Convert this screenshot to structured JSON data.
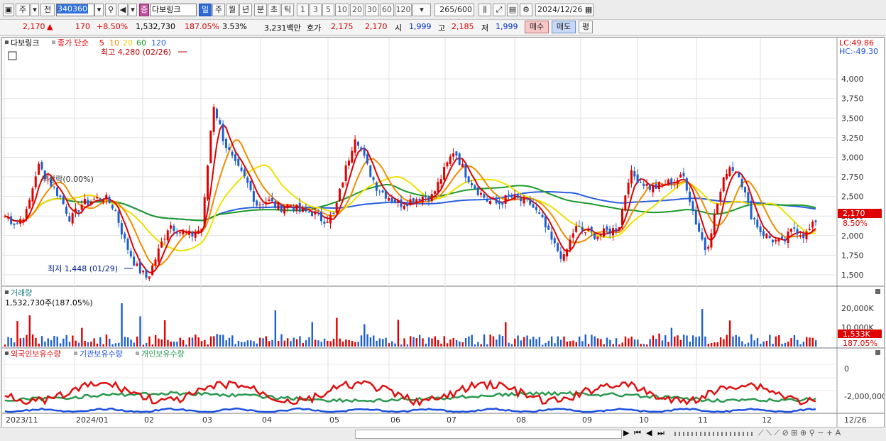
{
  "toolbar": {
    "period_main": "주",
    "prev_label": "전",
    "code": "340360",
    "stock_name": "다보링크",
    "badge": "증",
    "periods": [
      "일",
      "주",
      "월",
      "년",
      "분",
      "초",
      "틱"
    ],
    "intervals": [
      "1",
      "3",
      "5",
      "10",
      "20",
      "30",
      "60",
      "120"
    ],
    "count": "265",
    "count_total": "600",
    "date": "2024/12/26"
  },
  "quote": {
    "price": "2,170",
    "arrow": "▲",
    "change": "170",
    "change_pct": "+8.50%",
    "volume": "1,532,730",
    "vol_ratio": "187.05%",
    "turnover": "3.53%",
    "amount": "3,231백만",
    "bid_label": "호가",
    "ask": "2,175",
    "bid": "2,170",
    "open_label": "시",
    "open": "1,999",
    "high_label": "고",
    "high": "2,185",
    "low_label": "저",
    "low": "1,999",
    "buy_button": "매수",
    "sell_button": "매도",
    "eval_button": "평"
  },
  "price_panel": {
    "title": "다보링크",
    "legend_prefix": "종가 단순",
    "ma_periods": [
      "5",
      "10",
      "20",
      "60",
      "120"
    ],
    "max_annot": "최고 4,280 (02/26)",
    "min_annot": "최저 1,448 (01/29)",
    "ex_annot": "무상락(0.00%)",
    "lc": "LC:49.86",
    "hc": "HC:-49.30",
    "y_ticks": [
      "4,000",
      "3,750",
      "3,500",
      "3,250",
      "3,000",
      "2,750",
      "2,500",
      "2,250",
      "2,000",
      "1,750",
      "1,500"
    ],
    "last_price_tag": "2,170",
    "last_pct_tag": "8.50%"
  },
  "volume_panel": {
    "title": "거래량",
    "value": "1,532,730주(187.05%)",
    "y_ticks": [
      "20,000K",
      "10,000K"
    ],
    "last_tag": "1,533K",
    "last_pct": "187.05%"
  },
  "holdings_panel": {
    "legend": [
      "외국인보유수량",
      "기관보유수량",
      "개인보유수량"
    ],
    "y_ticks": [
      "0",
      "-2,000,000"
    ]
  },
  "x_axis": {
    "labels": [
      "2023/11",
      "2024/01",
      "02",
      "03",
      "04",
      "05",
      "06",
      "07",
      "08",
      "09",
      "10",
      "11",
      "12"
    ],
    "end_label": "12/26"
  },
  "colors": {
    "up": "#e00000",
    "down": "#1e5fd0",
    "ma5": "#e00000",
    "ma10": "#f08c00",
    "ma20": "#f0e000",
    "ma60": "#1a9a2a",
    "ma120": "#2a5ee0",
    "foreign": "#e01010",
    "inst": "#1e50e0",
    "indiv": "#2a9a50"
  },
  "chart_data": {
    "type": "candlestick",
    "x_months": [
      "2023/11",
      "2024/01",
      "02",
      "03",
      "04",
      "05",
      "06",
      "07",
      "08",
      "09",
      "10",
      "11",
      "12"
    ],
    "ylim": [
      1400,
      4280
    ],
    "close_path": [
      2250,
      2150,
      2300,
      2900,
      2700,
      2500,
      2200,
      2400,
      2450,
      2500,
      2350,
      1900,
      1600,
      1450,
      1800,
      2150,
      2050,
      2000,
      2100,
      3700,
      3200,
      2900,
      2700,
      2400,
      2450,
      2350,
      2400,
      2300,
      2300,
      2200,
      2250,
      2800,
      3300,
      2900,
      2600,
      2500,
      2400,
      2450,
      2500,
      2500,
      2800,
      3100,
      2800,
      2600,
      2450,
      2400,
      2500,
      2450,
      2400,
      2200,
      1900,
      1700,
      2100,
      2050,
      2000,
      2050,
      2100,
      2800,
      2700,
      2600,
      2650,
      2700,
      2750,
      2200,
      1800,
      2400,
      2900,
      2800,
      2300,
      2050,
      1950,
      1900,
      2100,
      2000,
      2170
    ],
    "volume_tag": "1,533K",
    "annotations": {
      "max": "4,280 (02/26)",
      "min": "1,448 (01/29)"
    }
  }
}
